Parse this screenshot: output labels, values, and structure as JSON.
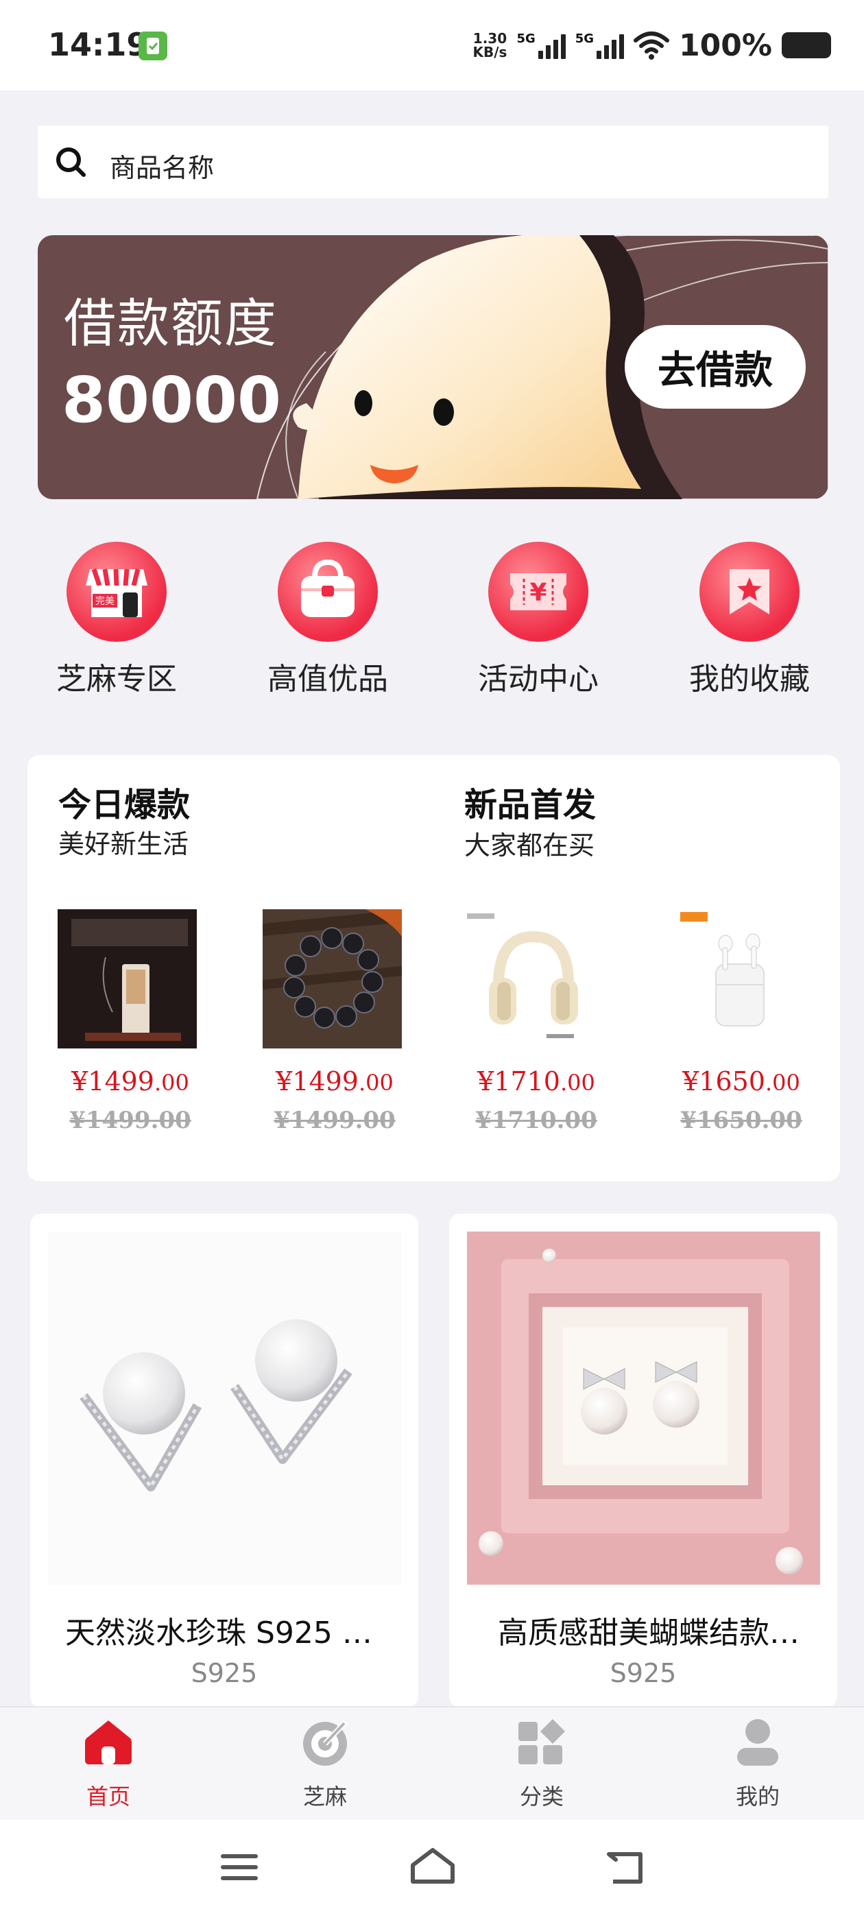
{
  "status_bar": {
    "time": "14:19",
    "speed_value": "1.30",
    "speed_unit": "KB/s",
    "signal1_label": "5G",
    "signal2_label": "5G",
    "battery_percent": "100%"
  },
  "search": {
    "placeholder": "商品名称"
  },
  "banner": {
    "title": "借款额度",
    "amount": "80000",
    "button_label": "去借款"
  },
  "quick_nav": [
    {
      "label": "芝麻专区",
      "icon": "shop-icon",
      "icon_text": "完美"
    },
    {
      "label": "高值优品",
      "icon": "handbag-icon"
    },
    {
      "label": "活动中心",
      "icon": "ticket-icon",
      "icon_text": "¥"
    },
    {
      "label": "我的收藏",
      "icon": "favorite-star-icon"
    }
  ],
  "promo": {
    "left_title": "今日爆款",
    "left_subtitle": "美好新生活",
    "right_title": "新品首发",
    "right_subtitle": "大家都在买",
    "products": [
      {
        "price_symbol": "¥",
        "price_int": "1499",
        "price_cents": ".00",
        "old_price": "¥1499.00",
        "image": "incense"
      },
      {
        "price_symbol": "¥",
        "price_int": "1499",
        "price_cents": ".00",
        "old_price": "¥1499.00",
        "image": "bead-bracelet"
      },
      {
        "price_symbol": "¥",
        "price_int": "1710",
        "price_cents": ".00",
        "old_price": "¥1710.00",
        "image": "headphones"
      },
      {
        "price_symbol": "¥",
        "price_int": "1650",
        "price_cents": ".00",
        "old_price": "¥1650.00",
        "image": "earbuds"
      }
    ]
  },
  "products": [
    {
      "title": "天然淡水珍珠 S925 …",
      "subtitle": "S925",
      "image": "pearl-earrings"
    },
    {
      "title": "高质感甜美蝴蝶结款…",
      "subtitle": "S925",
      "image": "bow-pearl-earrings"
    }
  ],
  "tabs": [
    {
      "label": "首页",
      "icon": "home-icon",
      "active": true
    },
    {
      "label": "芝麻",
      "icon": "sesame-icon",
      "active": false
    },
    {
      "label": "分类",
      "icon": "category-icon",
      "active": false
    },
    {
      "label": "我的",
      "icon": "profile-icon",
      "active": false
    }
  ],
  "colors": {
    "accent": "#e01a26",
    "price": "#d6141c",
    "banner_bg": "#6a4a4a",
    "icon_red": "#ef2a45"
  }
}
